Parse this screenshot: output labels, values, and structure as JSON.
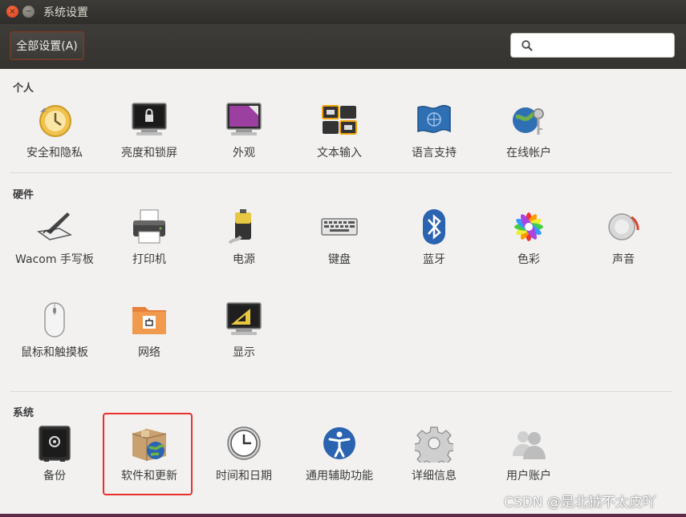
{
  "window": {
    "title": "系统设置",
    "close_glyph": "×",
    "minimize_glyph": "−"
  },
  "toolbar": {
    "all_settings_label": "全部设置(A)",
    "search_placeholder": "",
    "search_value": ""
  },
  "sections": {
    "personal": {
      "title": "个人",
      "items": [
        {
          "label": "安全和隐私",
          "icon": "security-privacy-icon"
        },
        {
          "label": "亮度和锁屏",
          "icon": "brightness-lock-icon"
        },
        {
          "label": "外观",
          "icon": "appearance-icon"
        },
        {
          "label": "文本输入",
          "icon": "text-entry-icon"
        },
        {
          "label": "语言支持",
          "icon": "language-support-icon"
        },
        {
          "label": "在线帐户",
          "icon": "online-accounts-icon"
        }
      ]
    },
    "hardware": {
      "title": "硬件",
      "items": [
        {
          "label": "Wacom 手写板",
          "icon": "wacom-tablet-icon"
        },
        {
          "label": "打印机",
          "icon": "printer-icon"
        },
        {
          "label": "电源",
          "icon": "power-icon"
        },
        {
          "label": "键盘",
          "icon": "keyboard-icon"
        },
        {
          "label": "蓝牙",
          "icon": "bluetooth-icon"
        },
        {
          "label": "色彩",
          "icon": "color-icon"
        },
        {
          "label": "声音",
          "icon": "sound-icon"
        },
        {
          "label": "鼠标和触摸板",
          "icon": "mouse-touchpad-icon"
        },
        {
          "label": "网络",
          "icon": "network-icon"
        },
        {
          "label": "显示",
          "icon": "display-icon"
        }
      ]
    },
    "system": {
      "title": "系统",
      "items": [
        {
          "label": "备份",
          "icon": "backup-icon"
        },
        {
          "label": "软件和更新",
          "icon": "software-updates-icon"
        },
        {
          "label": "时间和日期",
          "icon": "time-date-icon"
        },
        {
          "label": "通用辅助功能",
          "icon": "universal-access-icon"
        },
        {
          "label": "详细信息",
          "icon": "details-icon"
        },
        {
          "label": "用户账户",
          "icon": "user-accounts-icon"
        }
      ]
    }
  },
  "watermark": "CSDN @是北狨不太皮吖",
  "colors": {
    "titlebar": "#3c3b37",
    "content_bg": "#f2f1f0",
    "highlight": "#e8302c",
    "accent_orange": "#dd4814"
  }
}
